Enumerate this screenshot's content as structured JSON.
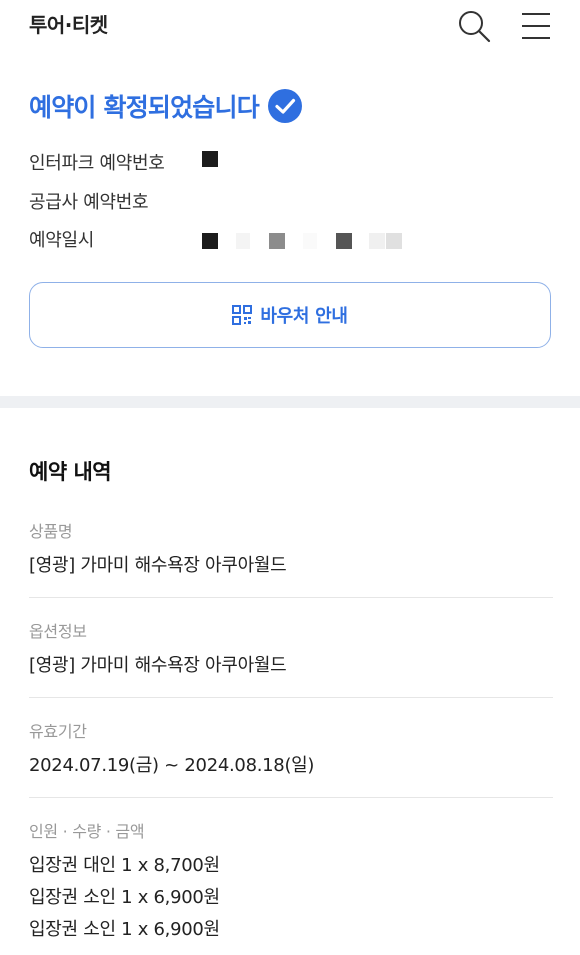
{
  "header": {
    "title": "투어·티켓",
    "search_icon": "search-icon",
    "menu_icon": "hamburger-menu-icon"
  },
  "confirmation": {
    "title": "예약이 확정되었습니다",
    "check_icon": "check-badge-icon",
    "accent_color": "#2f6fe0",
    "interpark_label": "인터파크 예약번호",
    "supplier_label": "공급사 예약번호",
    "datetime_label": "예약일시"
  },
  "voucher": {
    "icon": "qr-code-icon",
    "label": "바우처 안내"
  },
  "details": {
    "section_title": "예약 내역",
    "product": {
      "label": "상품명",
      "value": "[영광] 가마미 해수욕장 아쿠아월드"
    },
    "option": {
      "label": "옵션정보",
      "value": "[영광] 가마미 해수욕장 아쿠아월드"
    },
    "validity": {
      "label": "유효기간",
      "value": "2024.07.19(금) ~ 2024.08.18(일)"
    },
    "quantity": {
      "label": "인원 · 수량 · 금액",
      "items": [
        "입장권 대인 1 x 8,700원",
        "입장권 소인 1 x 6,900원",
        "입장권 소인 1 x 6,900원"
      ]
    }
  }
}
